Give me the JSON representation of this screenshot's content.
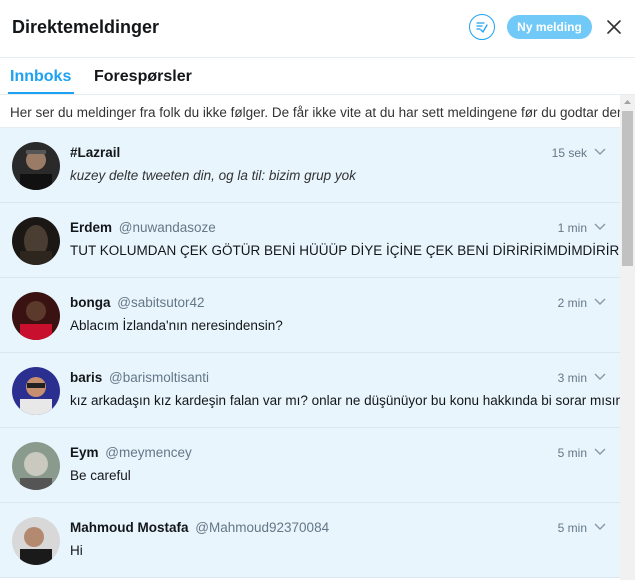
{
  "header": {
    "title": "Direktemeldinger",
    "new_message_label": "Ny melding",
    "accent": "#1da1f2"
  },
  "tabs": [
    {
      "label": "Innboks",
      "active": true
    },
    {
      "label": "Forespørsler",
      "active": false
    }
  ],
  "notice": "Her ser du meldinger fra folk du ikke følger. De får ikke vite at du har sett meldingene før du godtar dem.",
  "conversations": [
    {
      "name": "#Lazrail",
      "handle": "",
      "time": "15 sek",
      "message": "kuzey delte tweeten din, og la til: bizim grup yok",
      "italic": true
    },
    {
      "name": "Erdem",
      "handle": "@nuwandasoze",
      "time": "1 min",
      "message": "TUT KOLUMDAN ÇEK GÖTÜR BENİ HÜÜÜP DİYE İÇİNE ÇEK BENİ DİRİRİRİMDİMDİRİRİRİRİM",
      "italic": false
    },
    {
      "name": "bonga",
      "handle": "@sabitsutor42",
      "time": "2 min",
      "message": "Ablacım İzlanda'nın neresindensin?",
      "italic": false
    },
    {
      "name": "baris",
      "handle": "@barismoltisanti",
      "time": "3 min",
      "message": "kız arkadaşın kız kardeşin falan var mı? onlar ne düşünüyor bu konu hakkında bi sorar mısın",
      "italic": false
    },
    {
      "name": "Eym",
      "handle": "@meymencey",
      "time": "5 min",
      "message": "Be careful",
      "italic": false
    },
    {
      "name": "Mahmoud Mostafa",
      "handle": "@Mahmoud92370084",
      "time": "5 min",
      "message": "Hi",
      "italic": false
    }
  ]
}
